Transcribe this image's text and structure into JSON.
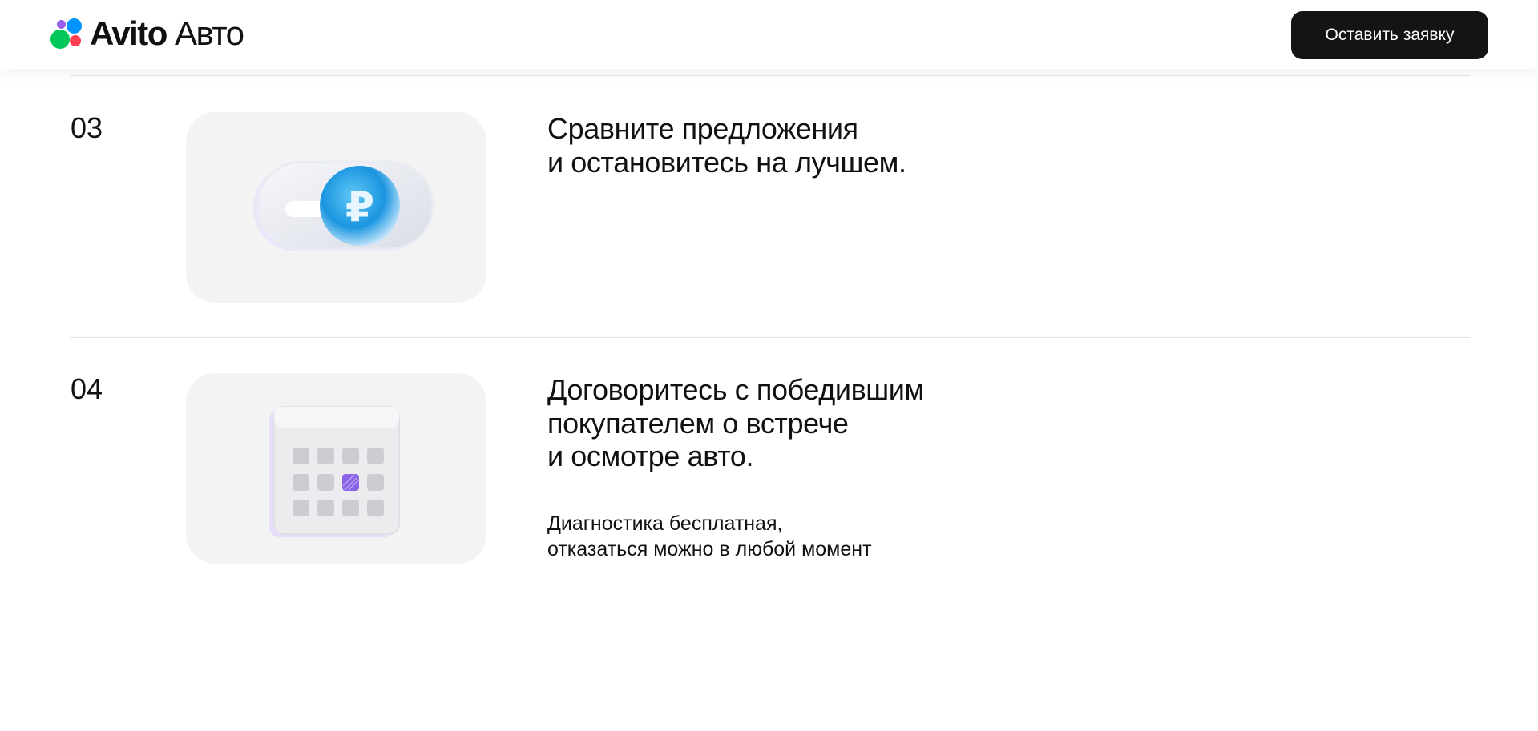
{
  "header": {
    "logo_brand": "Avito",
    "logo_suffix": "Авто",
    "cta_label": "Оставить заявку"
  },
  "steps": [
    {
      "number": "03",
      "title_lines": [
        "Сравните предложения",
        "и остановитесь на лучшем."
      ],
      "icon": "ruble-toggle-icon"
    },
    {
      "number": "04",
      "title_lines": [
        "Договоритесь с победившим",
        "покупателем о встрече",
        "и осмотре авто."
      ],
      "note_lines": [
        "Диагностика бесплатная,",
        "отказаться можно в любой момент"
      ],
      "icon": "calendar-icon"
    }
  ],
  "colors": {
    "accent_dark": "#141414",
    "card_bg": "#f3f3f3",
    "ruble_blue": "#2aa7e8",
    "calendar_highlight": "#8a63e6"
  }
}
